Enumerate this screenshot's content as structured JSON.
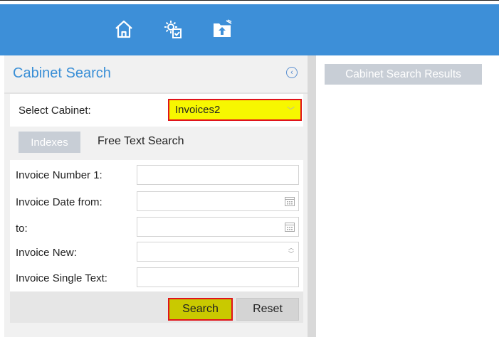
{
  "toolbar": {
    "icons": [
      "home-icon",
      "settings-document-icon",
      "folder-upload-icon"
    ],
    "background": "#3d8fd8"
  },
  "search_panel": {
    "title": "Cabinet Search",
    "select_cabinet_label": "Select Cabinet:",
    "selected_cabinet": "Invoices2",
    "tabs": [
      {
        "label": "Indexes",
        "active": true
      },
      {
        "label": "Free Text Search",
        "active": false
      }
    ],
    "fields": [
      {
        "label": "Invoice Number 1:",
        "value": "",
        "kind": "text"
      },
      {
        "label": "Invoice Date from:",
        "value": "",
        "kind": "date"
      },
      {
        "label": "to:",
        "value": "",
        "kind": "date"
      },
      {
        "label": "Invoice New:",
        "value": "",
        "kind": "select"
      },
      {
        "label": "Invoice Single Text:",
        "value": "",
        "kind": "text"
      }
    ],
    "search_button": "Search",
    "reset_button": "Reset"
  },
  "results_panel": {
    "tab_label": "Cabinet Search Results"
  },
  "colors": {
    "accent": "#3a8fd6",
    "highlight_border": "#e0141b",
    "highlight_fill": "#f7f700"
  }
}
